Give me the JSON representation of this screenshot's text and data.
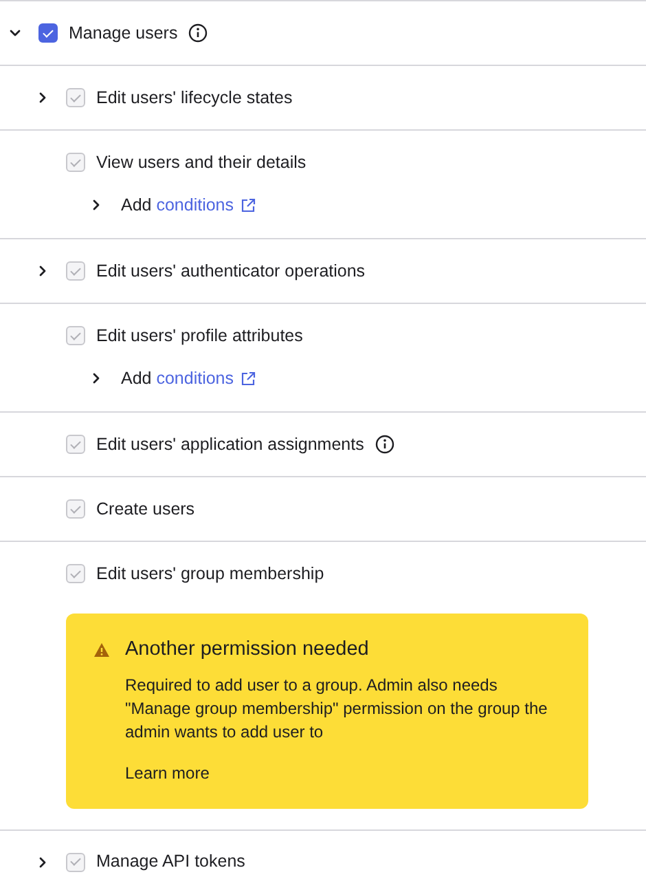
{
  "group": {
    "label": "Manage users",
    "expanded": true,
    "checked": true,
    "disabled": false,
    "info": true
  },
  "permissions": [
    {
      "label": "Edit users' lifecycle states",
      "expandable": true,
      "expanded": false,
      "checked": true,
      "disabled": true,
      "info": false
    },
    {
      "label": "View users and their details",
      "expandable": false,
      "checked": true,
      "disabled": true,
      "info": false,
      "conditions": {
        "prefix": "Add",
        "link": "conditions",
        "expanded": false
      }
    },
    {
      "label": "Edit users' authenticator operations",
      "expandable": true,
      "expanded": false,
      "checked": true,
      "disabled": true,
      "info": false
    },
    {
      "label": "Edit users' profile attributes",
      "expandable": false,
      "checked": true,
      "disabled": true,
      "info": false,
      "conditions": {
        "prefix": "Add",
        "link": "conditions",
        "expanded": false
      }
    },
    {
      "label": "Edit users' application assignments",
      "expandable": false,
      "checked": true,
      "disabled": true,
      "info": true
    },
    {
      "label": "Create users",
      "expandable": false,
      "checked": true,
      "disabled": true,
      "info": false
    },
    {
      "label": "Edit users' group membership",
      "expandable": false,
      "checked": true,
      "disabled": true,
      "info": false,
      "warning": {
        "title": "Another permission needed",
        "body": "Required to add user to a group. Admin also needs \"Manage group membership\" permission on the group the admin wants to add user to",
        "link": "Learn more"
      }
    },
    {
      "label": "Manage API tokens",
      "expandable": true,
      "expanded": false,
      "checked": true,
      "disabled": true,
      "info": false
    }
  ]
}
